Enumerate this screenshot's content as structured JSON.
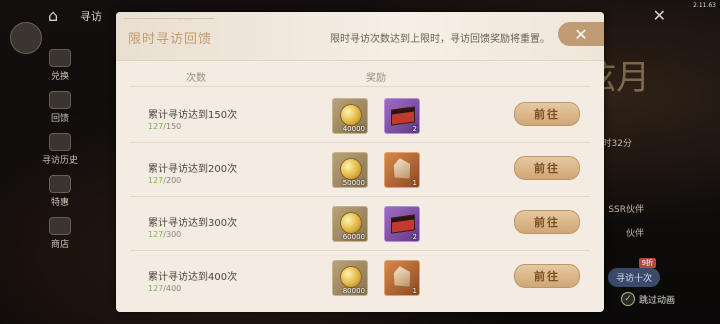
{
  "version": "2.11.63",
  "background": {
    "nav_title": "寻访",
    "left_menu": [
      {
        "label": "兑换",
        "icon": "exchange-icon"
      },
      {
        "label": "回馈",
        "icon": "feedback-icon"
      },
      {
        "label": "寻访历史",
        "icon": "history-icon"
      },
      {
        "label": "特惠",
        "icon": "deal-icon"
      },
      {
        "label": "商店",
        "icon": "shop-icon"
      }
    ],
    "right_texts": {
      "time": "时32分",
      "ssr": "SSR伙伴",
      "ur": "伙伴",
      "nine": "9折",
      "visit_ten": "寻访十次"
    },
    "skip_anim": "跳过动画"
  },
  "panel": {
    "title": "限时寻访回馈",
    "note": "限时寻访次数达到上限时，寻访回馈奖励将重置。",
    "col_count": "次数",
    "col_reward": "奖励",
    "rows": [
      {
        "title": "累计寻访达到150次",
        "current": "127",
        "total": "/150",
        "coin_qty": "40000",
        "box_qty": "2",
        "box_type": "purple",
        "button": "前往"
      },
      {
        "title": "累计寻访达到200次",
        "current": "127",
        "total": "/200",
        "coin_qty": "50000",
        "box_qty": "1",
        "box_type": "orange",
        "button": "前往"
      },
      {
        "title": "累计寻访达到300次",
        "current": "127",
        "total": "/300",
        "coin_qty": "60000",
        "box_qty": "2",
        "box_type": "purple",
        "button": "前往"
      },
      {
        "title": "累计寻访达到400次",
        "current": "127",
        "total": "/400",
        "coin_qty": "80000",
        "box_qty": "1",
        "box_type": "orange",
        "button": "前往"
      }
    ]
  }
}
